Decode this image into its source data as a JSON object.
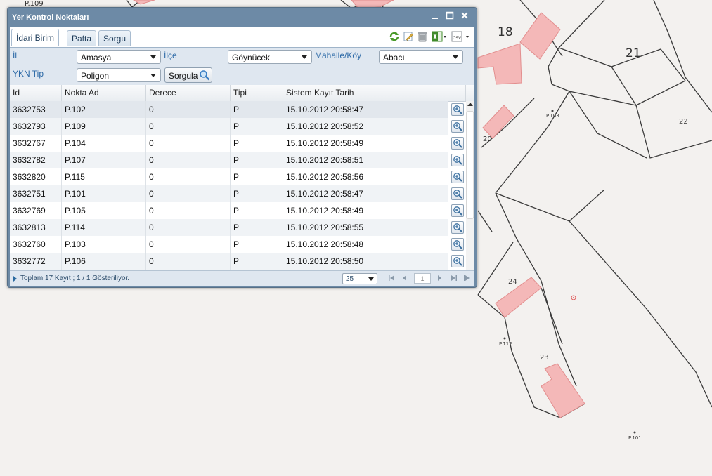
{
  "map": {
    "parcel_numbers": [
      "18",
      "21",
      "20",
      "22",
      "24",
      "23"
    ],
    "point_labels": [
      "P.109",
      "P.103",
      "P.112",
      "P.101"
    ]
  },
  "window": {
    "title": "Yer Kontrol Noktaları",
    "tabs": [
      {
        "label": "İdari Birim",
        "active": true
      },
      {
        "label": "Pafta",
        "active": false
      },
      {
        "label": "Sorgu",
        "active": false
      }
    ],
    "toolbar_icons": [
      "refresh-icon",
      "edit-icon",
      "delete-icon",
      "excel-icon",
      "csv-icon"
    ]
  },
  "form": {
    "il_label": "İl",
    "il_value": "Amasya",
    "ilce_label": "İlçe",
    "ilce_value": "Göynücek",
    "mahalle_label": "Mahalle/Köy",
    "mahalle_value": "Abacı",
    "ykn_label": "YKN Tip",
    "ykn_value": "Poligon",
    "search_label": "Sorgula"
  },
  "grid": {
    "columns": [
      "Id",
      "Nokta Ad",
      "Derece",
      "Tipi",
      "Sistem Kayıt Tarih"
    ],
    "rows": [
      [
        "3632753",
        "P.102",
        "0",
        "P",
        "15.10.2012 20:58:47"
      ],
      [
        "3632793",
        "P.109",
        "0",
        "P",
        "15.10.2012 20:58:52"
      ],
      [
        "3632767",
        "P.104",
        "0",
        "P",
        "15.10.2012 20:58:49"
      ],
      [
        "3632782",
        "P.107",
        "0",
        "P",
        "15.10.2012 20:58:51"
      ],
      [
        "3632820",
        "P.115",
        "0",
        "P",
        "15.10.2012 20:58:56"
      ],
      [
        "3632751",
        "P.101",
        "0",
        "P",
        "15.10.2012 20:58:47"
      ],
      [
        "3632769",
        "P.105",
        "0",
        "P",
        "15.10.2012 20:58:49"
      ],
      [
        "3632813",
        "P.114",
        "0",
        "P",
        "15.10.2012 20:58:55"
      ],
      [
        "3632760",
        "P.103",
        "0",
        "P",
        "15.10.2012 20:58:48"
      ],
      [
        "3632772",
        "P.106",
        "0",
        "P",
        "15.10.2012 20:58:50"
      ]
    ]
  },
  "footer": {
    "status": "Toplam 17 Kayıt ; 1 / 1 Gösteriliyor.",
    "page_size": "25",
    "page": "1"
  },
  "colors": {
    "window_frame": "#6d8aa6",
    "label_blue": "#2d6aa7",
    "parcel_fill": "#f4b8b8",
    "map_bg": "#f3f1ef"
  }
}
